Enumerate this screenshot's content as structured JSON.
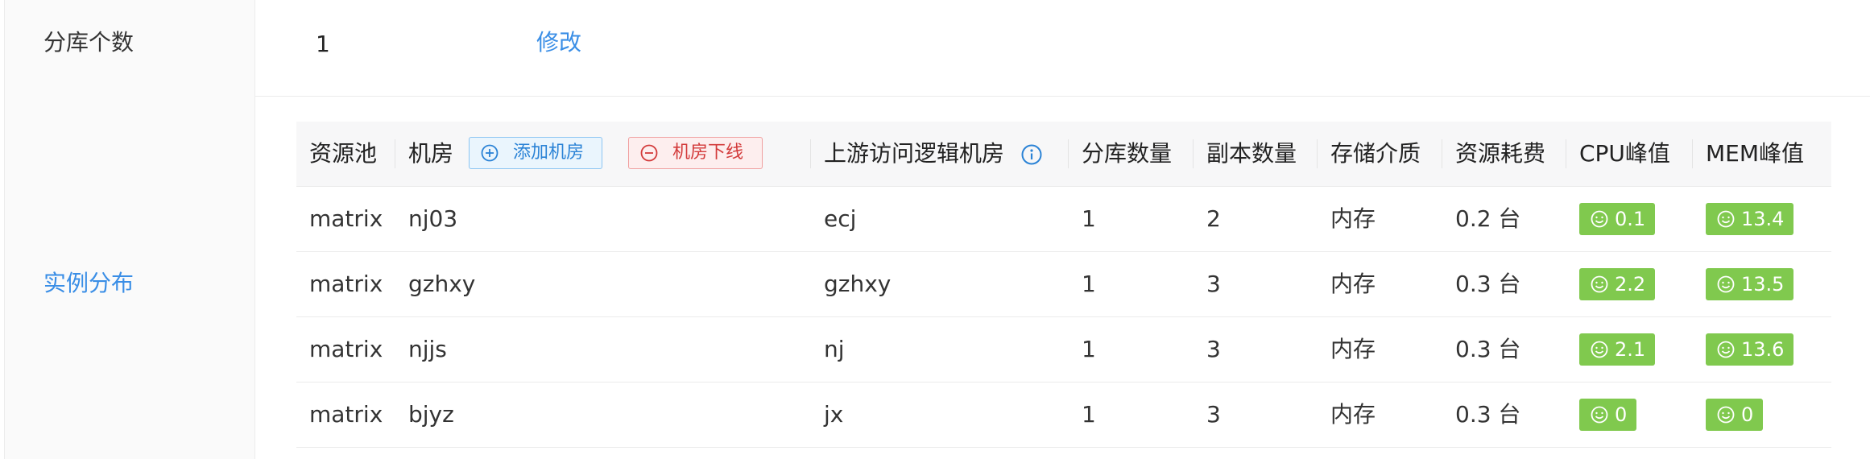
{
  "form": {
    "shard_count_label": "分库个数",
    "shard_count_value": "1",
    "modify_link": "修改",
    "instance_label": "实例分布"
  },
  "table": {
    "headers": {
      "pool": "资源池",
      "room": "机房",
      "add_room": "添加机房",
      "offline_room": "机房下线",
      "upstream": "上游访问逻辑机房",
      "shards": "分库数量",
      "replicas": "副本数量",
      "medium": "存储介质",
      "cost": "资源耗费",
      "cpu": "CPU峰值",
      "mem": "MEM峰值"
    },
    "rows": [
      {
        "pool": "matrix",
        "room": "nj03",
        "upstream": "ecj",
        "shards": "1",
        "replicas": "2",
        "medium": "内存",
        "cost": "0.2 台",
        "cpu": "0.1",
        "mem": "13.4"
      },
      {
        "pool": "matrix",
        "room": "gzhxy",
        "upstream": "gzhxy",
        "shards": "1",
        "replicas": "3",
        "medium": "内存",
        "cost": "0.3 台",
        "cpu": "2.2",
        "mem": "13.5"
      },
      {
        "pool": "matrix",
        "room": "njjs",
        "upstream": "nj",
        "shards": "1",
        "replicas": "3",
        "medium": "内存",
        "cost": "0.3 台",
        "cpu": "2.1",
        "mem": "13.6"
      },
      {
        "pool": "matrix",
        "room": "bjyz",
        "upstream": "jx",
        "shards": "1",
        "replicas": "3",
        "medium": "内存",
        "cost": "0.3 台",
        "cpu": "0",
        "mem": "0"
      }
    ]
  },
  "colors": {
    "accent": "#3a8ee6",
    "tag_green": "#80c94e",
    "danger": "#d33a3a"
  },
  "icons": {
    "add": "plus-circle-icon",
    "offline": "minus-circle-icon",
    "info": "info-circle-icon",
    "tag": "smile-icon"
  }
}
